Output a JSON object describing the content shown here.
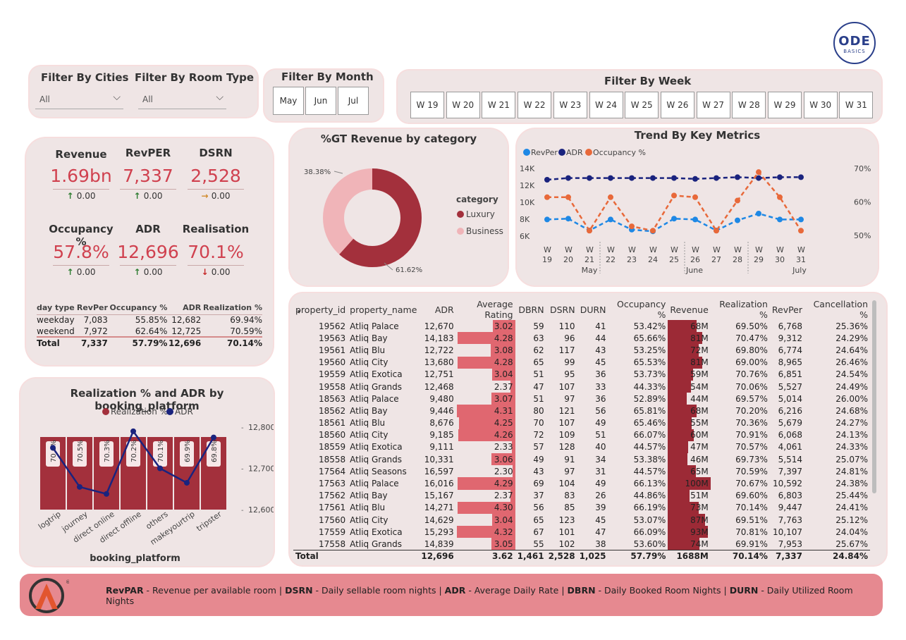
{
  "filters": {
    "cities": {
      "label": "Filter By Cities",
      "value": "All"
    },
    "room_type": {
      "label": "Filter By Room Type",
      "value": "All"
    },
    "month": {
      "label": "Filter By Month",
      "options": [
        "May",
        "Jun",
        "Jul"
      ]
    },
    "week": {
      "label": "Filter By Week",
      "options": [
        "W 19",
        "W 20",
        "W 21",
        "W 22",
        "W 23",
        "W 24",
        "W 25",
        "W 26",
        "W 27",
        "W 28",
        "W 29",
        "W 30",
        "W 31"
      ]
    }
  },
  "logo": {
    "text": "ODE",
    "sub": "BASICS"
  },
  "kpis": [
    {
      "title": "Revenue",
      "value": "1.69bn",
      "delta": "0.00",
      "dir": "up"
    },
    {
      "title": "RevPER",
      "value": "7,337",
      "delta": "0.00",
      "dir": "up"
    },
    {
      "title": "DSRN",
      "value": "2,528",
      "delta": "0.00",
      "dir": "right"
    },
    {
      "title": "Occupancy %",
      "value": "57.8%",
      "delta": "0.00",
      "dir": "up"
    },
    {
      "title": "ADR",
      "value": "12,696",
      "delta": "0.00",
      "dir": "up"
    },
    {
      "title": "Realisation",
      "value": "70.1%",
      "delta": "0.00",
      "dir": "down"
    }
  ],
  "daytype": {
    "headers": [
      "day type",
      "RevPer",
      "Occupancy %",
      "ADR",
      "Realization %"
    ],
    "rows": [
      [
        "weekday",
        "7,083",
        "55.85%",
        "12,682",
        "69.94%"
      ],
      [
        "weekend",
        "7,972",
        "62.64%",
        "12,725",
        "70.59%"
      ]
    ],
    "total": [
      "Total",
      "7,337",
      "57.79%",
      "12,696",
      "70.14%"
    ]
  },
  "donut": {
    "title": "%GT Revenue by category",
    "legend_title": "category",
    "luxury_label": "Luxury",
    "business_label": "Business",
    "luxury_pct": "61.62%",
    "business_pct": "38.38%",
    "colors": {
      "luxury": "#a3303c",
      "business": "#f0b4b8"
    }
  },
  "trend": {
    "title": "Trend By Key Metrics",
    "legend": [
      "RevPer",
      "ADR",
      "Occupancy %"
    ],
    "y_left": [
      "14K",
      "12K",
      "10K",
      "8K",
      "6K"
    ],
    "y_right": [
      "70%",
      "60%",
      "50%"
    ],
    "months": [
      "May",
      "June",
      "July"
    ]
  },
  "platform": {
    "title": "Realization % and ADR by booking_platform",
    "legend": [
      "Realization %",
      "ADR"
    ],
    "xlabel": "booking_platform",
    "y_right": [
      "12,800",
      "12,700",
      "12,600"
    ]
  },
  "table": {
    "headers": [
      "property_id",
      "property_name",
      "ADR",
      "Average Rating",
      "DBRN",
      "DSRN",
      "DURN",
      "Occupancy %",
      "Revenue",
      "Realization %",
      "RevPer",
      "Cancellation %"
    ],
    "rows": [
      [
        "19562",
        "Atliq Palace",
        "12,670",
        "3.02",
        "59",
        "110",
        "41",
        "53.42%",
        "68M",
        "69.50%",
        "6,768",
        "25.36%"
      ],
      [
        "19563",
        "Atliq Bay",
        "14,183",
        "4.28",
        "63",
        "96",
        "44",
        "65.66%",
        "81M",
        "70.47%",
        "9,312",
        "24.29%"
      ],
      [
        "19561",
        "Atliq Blu",
        "12,722",
        "3.08",
        "62",
        "117",
        "43",
        "53.25%",
        "72M",
        "69.80%",
        "6,774",
        "24.64%"
      ],
      [
        "19560",
        "Atliq City",
        "13,680",
        "4.28",
        "65",
        "99",
        "45",
        "65.53%",
        "81M",
        "69.00%",
        "8,965",
        "26.46%"
      ],
      [
        "19559",
        "Atliq Exotica",
        "12,751",
        "3.04",
        "51",
        "95",
        "36",
        "53.73%",
        "59M",
        "70.76%",
        "6,851",
        "24.54%"
      ],
      [
        "19558",
        "Atliq Grands",
        "12,468",
        "2.37",
        "47",
        "107",
        "33",
        "44.33%",
        "54M",
        "70.06%",
        "5,527",
        "24.49%"
      ],
      [
        "18563",
        "Atliq Palace",
        "9,480",
        "3.07",
        "51",
        "97",
        "36",
        "52.89%",
        "44M",
        "69.57%",
        "5,014",
        "26.00%"
      ],
      [
        "18562",
        "Atliq Bay",
        "9,446",
        "4.31",
        "80",
        "121",
        "56",
        "65.81%",
        "68M",
        "70.20%",
        "6,216",
        "24.68%"
      ],
      [
        "18561",
        "Atliq Blu",
        "8,676",
        "4.25",
        "70",
        "107",
        "49",
        "65.46%",
        "55M",
        "70.36%",
        "5,679",
        "24.27%"
      ],
      [
        "18560",
        "Atliq City",
        "9,185",
        "4.26",
        "72",
        "109",
        "51",
        "66.07%",
        "60M",
        "70.91%",
        "6,068",
        "24.13%"
      ],
      [
        "18559",
        "Atliq Exotica",
        "9,111",
        "2.33",
        "57",
        "128",
        "40",
        "44.57%",
        "47M",
        "70.57%",
        "4,061",
        "24.33%"
      ],
      [
        "18558",
        "Atliq Grands",
        "10,331",
        "3.06",
        "49",
        "91",
        "34",
        "53.38%",
        "46M",
        "69.73%",
        "5,514",
        "25.07%"
      ],
      [
        "17564",
        "Atliq Seasons",
        "16,597",
        "2.30",
        "43",
        "97",
        "31",
        "44.57%",
        "65M",
        "70.59%",
        "7,397",
        "24.81%"
      ],
      [
        "17563",
        "Atliq Palace",
        "16,016",
        "4.29",
        "69",
        "104",
        "49",
        "66.13%",
        "100M",
        "70.67%",
        "10,592",
        "24.38%"
      ],
      [
        "17562",
        "Atliq Bay",
        "15,167",
        "2.37",
        "37",
        "83",
        "26",
        "44.86%",
        "51M",
        "69.60%",
        "6,803",
        "25.44%"
      ],
      [
        "17561",
        "Atliq Blu",
        "14,271",
        "4.30",
        "56",
        "85",
        "39",
        "66.19%",
        "73M",
        "70.14%",
        "9,447",
        "24.41%"
      ],
      [
        "17560",
        "Atliq City",
        "14,629",
        "3.04",
        "65",
        "123",
        "45",
        "53.07%",
        "87M",
        "69.51%",
        "7,763",
        "25.12%"
      ],
      [
        "17559",
        "Atliq Exotica",
        "15,293",
        "4.32",
        "67",
        "101",
        "47",
        "66.09%",
        "93M",
        "70.81%",
        "10,107",
        "24.04%"
      ],
      [
        "17558",
        "Atliq Grands",
        "14,839",
        "3.05",
        "55",
        "102",
        "38",
        "53.60%",
        "74M",
        "69.91%",
        "7,953",
        "25.67%"
      ]
    ],
    "total": [
      "Total",
      "",
      "12,696",
      "3.62",
      "1,461",
      "2,528",
      "1,025",
      "57.79%",
      "1688M",
      "70.14%",
      "7,337",
      "24.84%"
    ]
  },
  "footer": {
    "text": "RevPAR - Revenue per available room | DSRN - Daily sellable room nights | ADR - Average Daily Rate | DBRN - Daily Booked Room Nights | DURN - Daily Utilized Room Nights"
  },
  "chart_data": [
    {
      "type": "pie",
      "title": "%GT Revenue by category",
      "categories": [
        "Luxury",
        "Business"
      ],
      "values": [
        61.62,
        38.38
      ]
    },
    {
      "type": "line",
      "title": "Trend By Key Metrics",
      "x": [
        "W 19",
        "W 20",
        "W 21",
        "W 22",
        "W 23",
        "W 24",
        "W 25",
        "W 26",
        "W 27",
        "W 28",
        "W 29",
        "W 30",
        "W 31"
      ],
      "series": [
        {
          "name": "RevPer",
          "axis": "left",
          "values": [
            7800,
            7900,
            6500,
            7800,
            6600,
            6400,
            7900,
            7800,
            6500,
            7700,
            8500,
            7800,
            7800
          ]
        },
        {
          "name": "ADR",
          "axis": "left",
          "values": [
            12500,
            12700,
            12700,
            12700,
            12700,
            12700,
            12700,
            12600,
            12700,
            12800,
            12700,
            12800,
            12800
          ]
        },
        {
          "name": "Occupancy %",
          "axis": "right",
          "values": [
            61.2,
            61.2,
            51.2,
            61.2,
            52.5,
            51.2,
            61.7,
            61.2,
            51.2,
            60.2,
            68.7,
            61.2,
            51.2
          ]
        }
      ],
      "ylim_left": [
        6000,
        14000
      ],
      "ylim_right": [
        50,
        70
      ]
    },
    {
      "type": "bar",
      "title": "Realization % and ADR by booking_platform",
      "categories": [
        "logtrip",
        "journey",
        "direct online",
        "direct offline",
        "others",
        "makeyourtrip",
        "tripster"
      ],
      "series": [
        {
          "name": "Realization %",
          "values": [
            70.6,
            70.5,
            70.3,
            70.2,
            70.1,
            69.9,
            69.8
          ]
        },
        {
          "name": "ADR",
          "values": [
            12750,
            12655,
            12638,
            12790,
            12700,
            12665,
            12775
          ]
        }
      ],
      "xlabel": "booking_platform",
      "ylim_right": [
        12600,
        12800
      ]
    }
  ],
  "colors": {
    "accent": "#d0414f",
    "panel": "#efe5e5",
    "revper": "#1e88e5",
    "adr": "#1a237e",
    "occupancy": "#e8693a",
    "bar": "#a3303c",
    "footer": "#e68990"
  }
}
